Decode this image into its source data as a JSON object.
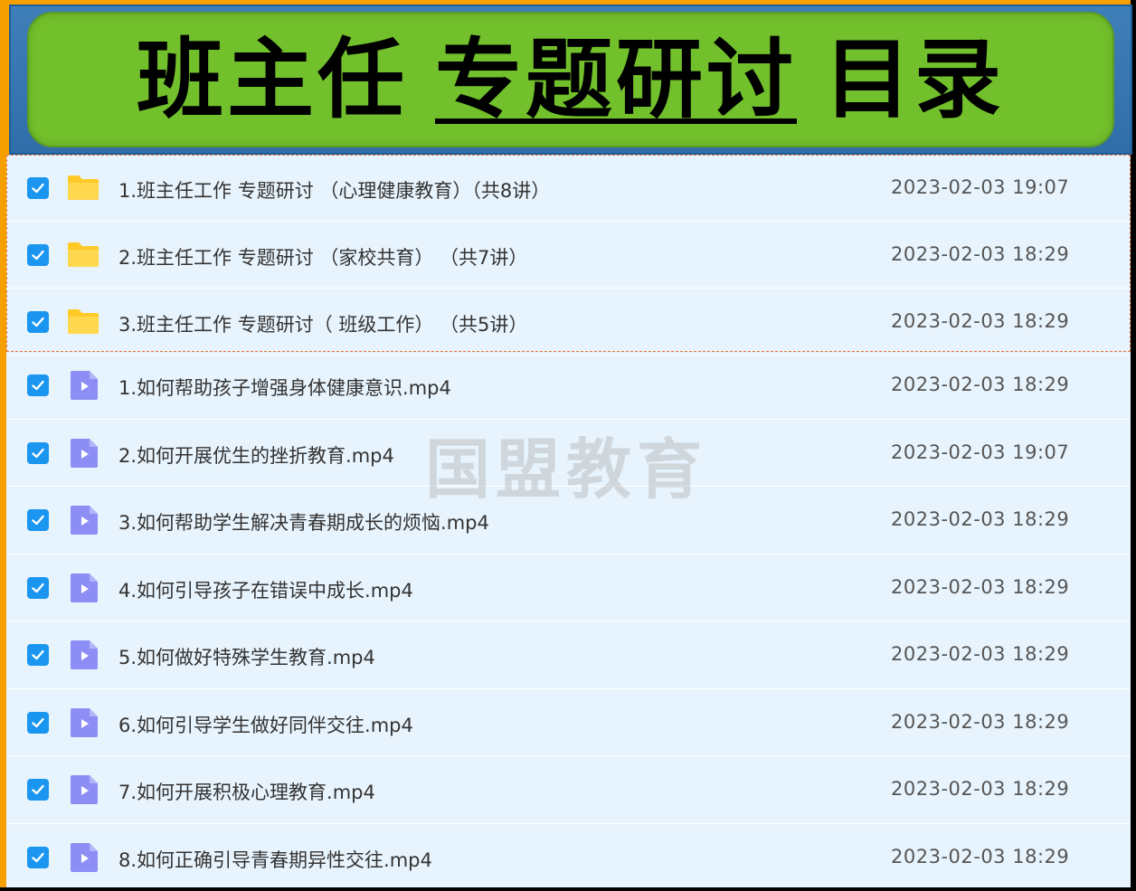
{
  "banner": {
    "part1": "班主任",
    "part2": "专题研讨",
    "part3": "目录"
  },
  "watermark": "国盟教育",
  "colors": {
    "banner_green": "#72c02b",
    "banner_blue": "#2f6ea8",
    "checkbox": "#1a96f0",
    "folder": "#ffd43b",
    "video": "#8c8ef5",
    "list_bg": "#e8f4fd",
    "frame_orange": "#f5a000"
  },
  "folders": [
    {
      "icon": "folder-icon",
      "name": "1.班主任工作  专题研讨 （心理健康教育）（共8讲）",
      "date": "2023-02-03 19:07",
      "checked": true
    },
    {
      "icon": "folder-icon",
      "name": "2.班主任工作  专题研讨 （家校共育） （共7讲）",
      "date": "2023-02-03 18:29",
      "checked": true
    },
    {
      "icon": "folder-icon",
      "name": "3.班主任工作  专题研讨（ 班级工作） （共5讲）",
      "date": "2023-02-03 18:29",
      "checked": true
    }
  ],
  "files": [
    {
      "icon": "video-file-icon",
      "name": "1.如何帮助孩子增强身体健康意识.mp4",
      "date": "2023-02-03 18:29",
      "checked": true
    },
    {
      "icon": "video-file-icon",
      "name": "2.如何开展优生的挫折教育.mp4",
      "date": "2023-02-03 19:07",
      "checked": true
    },
    {
      "icon": "video-file-icon",
      "name": "3.如何帮助学生解决青春期成长的烦恼.mp4",
      "date": "2023-02-03 18:29",
      "checked": true
    },
    {
      "icon": "video-file-icon",
      "name": "4.如何引导孩子在错误中成长.mp4",
      "date": "2023-02-03 18:29",
      "checked": true
    },
    {
      "icon": "video-file-icon",
      "name": "5.如何做好特殊学生教育.mp4",
      "date": "2023-02-03 18:29",
      "checked": true
    },
    {
      "icon": "video-file-icon",
      "name": "6.如何引导学生做好同伴交往.mp4",
      "date": "2023-02-03 18:29",
      "checked": true
    },
    {
      "icon": "video-file-icon",
      "name": "7.如何开展积极心理教育.mp4",
      "date": "2023-02-03 18:29",
      "checked": true
    },
    {
      "icon": "video-file-icon",
      "name": "8.如何正确引导青春期异性交往.mp4",
      "date": "2023-02-03 18:29",
      "checked": true
    }
  ]
}
